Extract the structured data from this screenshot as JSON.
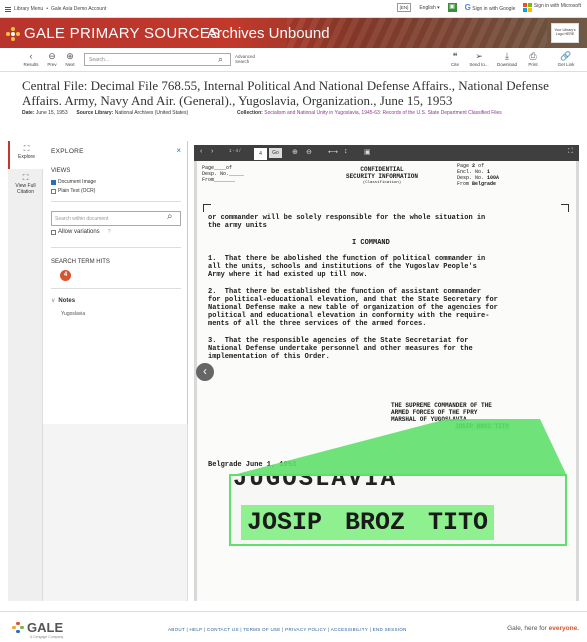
{
  "topbar": {
    "library_menu": "Library Menu",
    "account": "Gale Asia Demo Account",
    "lang_chip": "[EN]",
    "lang": "English ▾",
    "google": "Sign in with Google",
    "microsoft": "Sign in with Microsoft"
  },
  "banner": {
    "brand": "GALE PRIMARY SOURCES",
    "collection": "Archives Unbound",
    "logo_text": "Your Library's Logo HERE"
  },
  "toolbar": {
    "results": "Results",
    "prev": "Prev",
    "next": "Next",
    "search_placeholder": "Search...",
    "advanced_search": "Advanced Search",
    "cite": "Cite",
    "send_to": "Send to...",
    "download": "Download",
    "print": "Print",
    "get_link": "Get Link"
  },
  "document": {
    "title": "Central File: Decimal File 768.55, Internal Political And National Defense Affairs., National Defense Affairs. Army, Navy And Air. (General)., Yugoslavia, Organization., June 15, 1953",
    "date_label": "Date:",
    "date": "June 15, 1953",
    "source_label": "Source Library:",
    "source": "National Archives (United States)",
    "collection_label": "Collection:",
    "collection": "Socialism and National Unity in Yugoslavia, 1945-63: Records of the U.S. State Department Classified Files"
  },
  "rail": {
    "explore": "Explore",
    "view_full_citation": "View Full Citation"
  },
  "explore": {
    "header": "EXPLORE",
    "views_label": "VIEWS",
    "document_image": "Document Image",
    "plain_text": "Plain Text (OCR)",
    "search_within_placeholder": "Search within document",
    "allow_variations": "Allow variations",
    "search_term_hits": "SEARCH TERM HITS",
    "hit_count": "4",
    "notes_label": "Notes",
    "note_item": "Yugoslavia"
  },
  "viewer": {
    "page_of": "1 - 4 /",
    "page_value": "4",
    "go": "Go"
  },
  "scan": {
    "page_label": "Page",
    "page_num": "2",
    "page_of": "of",
    "desp_no": "Desp. No.",
    "from": "From",
    "encl_no_label": "Encl. No.",
    "encl_no": "1",
    "desp_no_val": "100A",
    "from_val": "Belgrade",
    "classification_1": "CONFIDENTIAL",
    "classification_2": "SECURITY INFORMATION",
    "classification_note": "(Classification)",
    "para0": "or commander will be solely responsible for the whole situation in\nthe army units",
    "command": "I COMMAND",
    "para1": "1.  That there be abolished the function of political commander in\nall the units, schools and institutions of the Yugoslav People's\nArmy where it had existed up till now.",
    "para2": "2.  That there be established the function of assistant commander\nfor political-educational elevation, and that the State Secretary for\nNational Defense make a new table of organization of the agencies for\npolitical and educational elevation in conformity with the require-\nments of all the three services of the armed forces.",
    "para3": "3.  That the responsible agencies of the State Secretariat for\nNational Defense undertake personnel and other measures for the\nimplementation of this Order.",
    "sig_block": "THE SUPREME COMMANDER OF THE\nARMED FORCES OF THE FPRY\nMARSHAL OF YUGOSLAVIA",
    "sig_name": "JOSIP BROZ TITO",
    "place_date": "Belgrade June 1, 1953",
    "zoom_top": "JUGOSLAVIA",
    "zoom_name": "JOSIP BROZ TITO"
  },
  "footer": {
    "brand": "GALE",
    "brand_sub": "A Cengage Company",
    "links": "ABOUT | HELP | CONTACT US | TERMS OF USE | PRIVACY POLICY | ACCESSIBILITY | END SESSION",
    "tagline": "Gale, here for",
    "tagline_em": "everyone."
  },
  "colors": {
    "banner_red": "#c0392b",
    "highlight_green": "#8ef08f",
    "zoom_green": "#5fe06a",
    "link_blue": "#2a5c99",
    "hit_orange": "#d9532c"
  }
}
